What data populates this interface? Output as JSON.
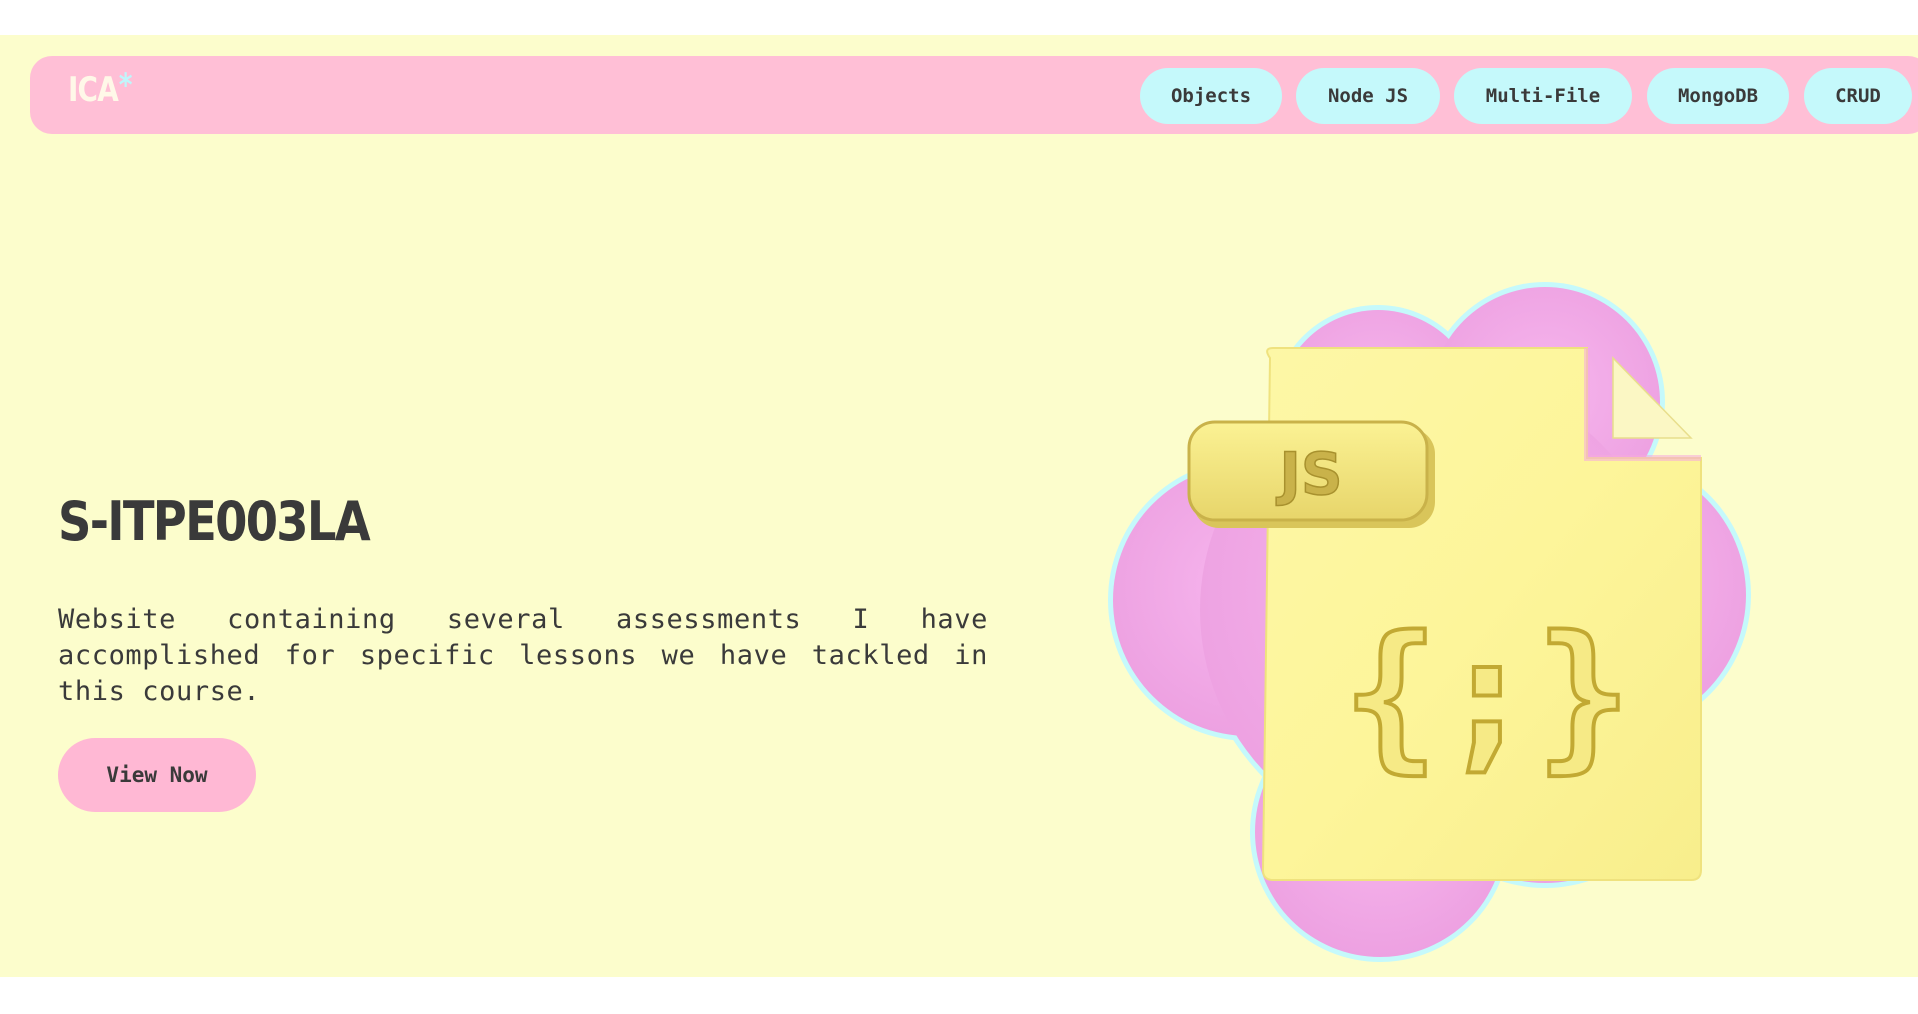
{
  "header": {
    "logo_text": "ICA",
    "logo_mark": "*",
    "nav": [
      {
        "label": "Objects"
      },
      {
        "label": "Node JS"
      },
      {
        "label": "Multi-File"
      },
      {
        "label": "MongoDB"
      },
      {
        "label": "CRUD"
      }
    ]
  },
  "hero": {
    "title": "S-ITPE003LA",
    "description": "Website containing several assessments I have accomplished for specific lessons we have tackled in this course.",
    "cta_label": "View Now",
    "illustration": {
      "icon": "js-file-icon",
      "file_label": "JS",
      "file_glyph": "{;}"
    }
  },
  "colors": {
    "page_background": "#fcfdcc",
    "navbar": "#ffbfd6",
    "nav_pill": "#c5f9fb",
    "button": "#ffb8d4",
    "text": "#3a3a3a",
    "blob": "#f0a6e4",
    "blob_outline": "#c5f9fb",
    "file": "#fdf69a"
  }
}
